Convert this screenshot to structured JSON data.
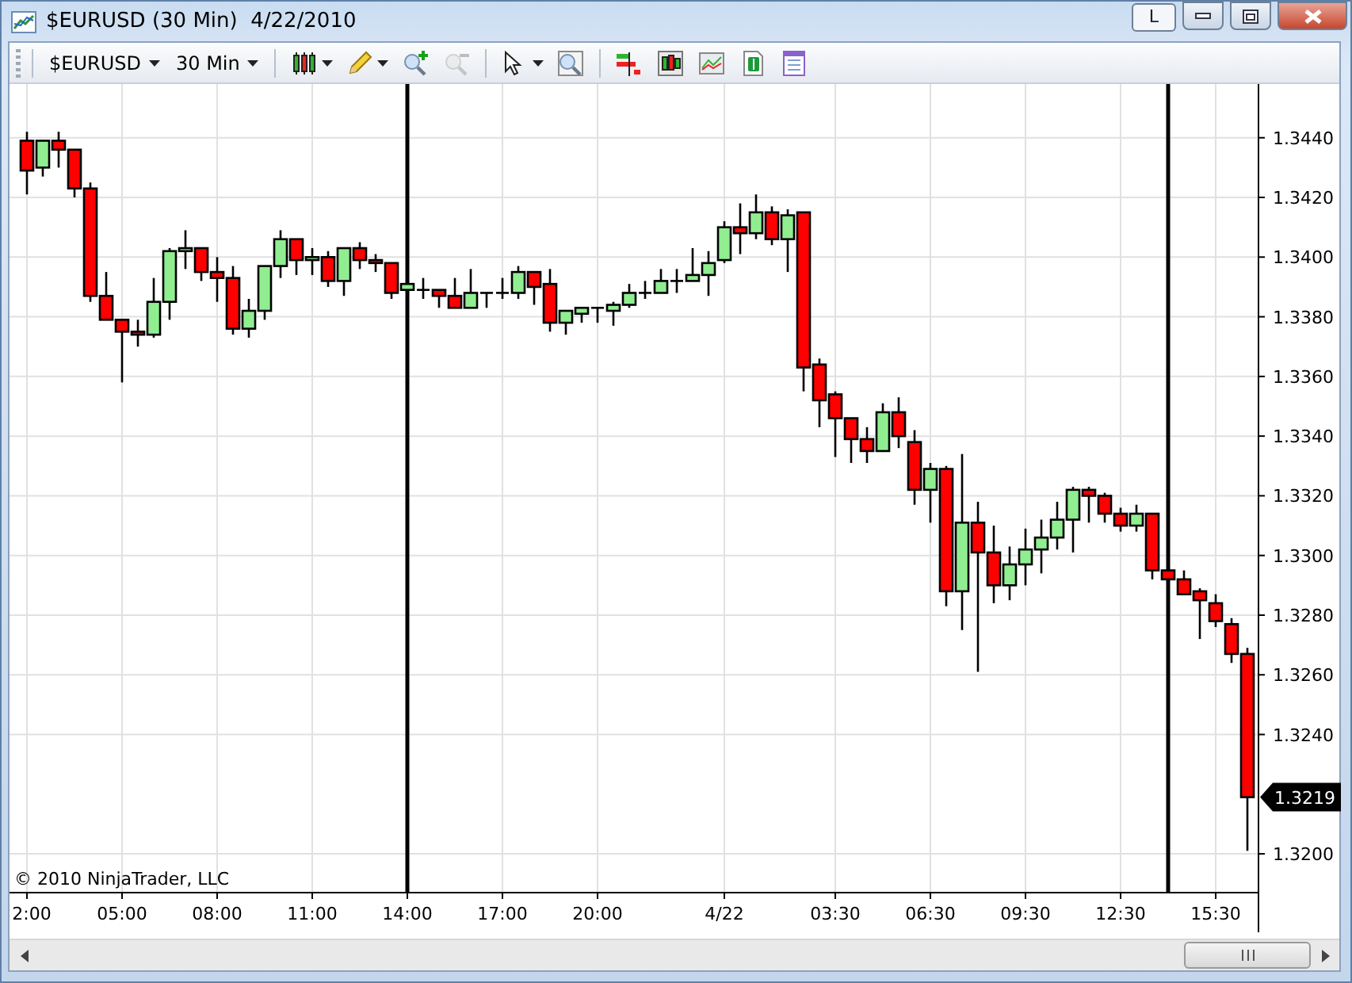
{
  "window": {
    "title": "$EURUSD (30 Min)  4/22/2010",
    "buttons": [
      {
        "kind": "link",
        "label": "L"
      },
      {
        "kind": "minimize"
      },
      {
        "kind": "maximize"
      },
      {
        "kind": "close"
      }
    ]
  },
  "toolbar": {
    "dropdowns": [
      {
        "label": "$EURUSD"
      },
      {
        "label": "30 Min"
      }
    ],
    "tools": [
      {
        "kind": "chart-style",
        "disabled": false
      },
      {
        "kind": "drawing",
        "disabled": false
      },
      {
        "kind": "zoom-in",
        "disabled": false
      },
      {
        "kind": "zoom-out",
        "disabled": true
      },
      {
        "kind": "separator"
      },
      {
        "kind": "select",
        "disabled": false
      },
      {
        "kind": "zoom",
        "disabled": false
      },
      {
        "kind": "separator"
      },
      {
        "kind": "strategies",
        "disabled": false
      },
      {
        "kind": "indicators",
        "disabled": false
      },
      {
        "kind": "line-chart",
        "disabled": false
      },
      {
        "kind": "account",
        "disabled": false
      },
      {
        "kind": "properties",
        "disabled": false
      }
    ]
  },
  "chart": {
    "copyright": "© 2010 NinjaTrader, LLC",
    "last_price": "1.3219",
    "chart_data": {
      "type": "candlestick",
      "grid": true,
      "ylim": [
        1.3187,
        1.3458
      ],
      "categories": [
        "2:00",
        null,
        null,
        null,
        null,
        null,
        "05:00",
        null,
        null,
        null,
        null,
        null,
        "08:00",
        null,
        null,
        null,
        null,
        null,
        "11:00",
        null,
        null,
        null,
        null,
        null,
        "14:00",
        null,
        null,
        null,
        null,
        null,
        "17:00",
        null,
        null,
        null,
        null,
        null,
        "20:00",
        null,
        null,
        null,
        null,
        null,
        null,
        null,
        "4/22",
        null,
        null,
        null,
        null,
        null,
        null,
        "03:30",
        null,
        null,
        null,
        null,
        null,
        "06:30",
        null,
        null,
        null,
        null,
        null,
        "09:30",
        null,
        null,
        null,
        null,
        null,
        "12:30",
        null,
        null,
        null,
        null,
        null,
        "15:30",
        null,
        null
      ],
      "yticks": [
        {
          "value": 1.32,
          "label": "1.3200"
        },
        {
          "value": 1.324,
          "label": "1.3240"
        },
        {
          "value": 1.326,
          "label": "1.3260"
        },
        {
          "value": 1.328,
          "label": "1.3280"
        },
        {
          "value": 1.33,
          "label": "1.3300"
        },
        {
          "value": 1.332,
          "label": "1.3320"
        },
        {
          "value": 1.334,
          "label": "1.3340"
        },
        {
          "value": 1.336,
          "label": "1.3360"
        },
        {
          "value": 1.338,
          "label": "1.3380"
        },
        {
          "value": 1.34,
          "label": "1.3400"
        },
        {
          "value": 1.342,
          "label": "1.3420"
        },
        {
          "value": 1.344,
          "label": "1.3440"
        }
      ],
      "ohlc": [
        [
          1.3439,
          1.3442,
          1.3421,
          1.3429
        ],
        [
          1.343,
          1.3439,
          1.3427,
          1.3439
        ],
        [
          1.3439,
          1.3442,
          1.343,
          1.3436
        ],
        [
          1.3436,
          1.3436,
          1.342,
          1.3423
        ],
        [
          1.3423,
          1.3425,
          1.3385,
          1.3387
        ],
        [
          1.3387,
          1.3395,
          1.3379,
          1.3379
        ],
        [
          1.3379,
          1.3379,
          1.3358,
          1.3375
        ],
        [
          1.3375,
          1.3379,
          1.337,
          1.3374
        ],
        [
          1.3374,
          1.3393,
          1.3373,
          1.3385
        ],
        [
          1.3385,
          1.3403,
          1.3379,
          1.3402
        ],
        [
          1.3402,
          1.3409,
          1.3396,
          1.3403
        ],
        [
          1.3403,
          1.3403,
          1.3392,
          1.3395
        ],
        [
          1.3395,
          1.34,
          1.3385,
          1.3393
        ],
        [
          1.3393,
          1.3397,
          1.3374,
          1.3376
        ],
        [
          1.3376,
          1.3386,
          1.3373,
          1.3382
        ],
        [
          1.3382,
          1.3397,
          1.3379,
          1.3397
        ],
        [
          1.3397,
          1.3409,
          1.3393,
          1.3406
        ],
        [
          1.3406,
          1.3406,
          1.3394,
          1.3399
        ],
        [
          1.3399,
          1.3403,
          1.3394,
          1.34
        ],
        [
          1.34,
          1.3402,
          1.339,
          1.3392
        ],
        [
          1.3392,
          1.3403,
          1.3387,
          1.3403
        ],
        [
          1.3403,
          1.3405,
          1.3396,
          1.3399
        ],
        [
          1.3399,
          1.3401,
          1.3395,
          1.3398
        ],
        [
          1.3398,
          1.3398,
          1.3386,
          1.3388
        ],
        [
          1.3389,
          1.3391,
          1.3389,
          1.3391
        ],
        [
          1.3389,
          1.3393,
          1.3386,
          1.3389
        ],
        [
          1.3389,
          1.3389,
          1.3383,
          1.3387
        ],
        [
          1.3387,
          1.3393,
          1.3383,
          1.3383
        ],
        [
          1.3383,
          1.3396,
          1.3383,
          1.3388
        ],
        [
          1.3388,
          1.3388,
          1.3383,
          1.3388
        ],
        [
          1.3388,
          1.3393,
          1.3386,
          1.3388
        ],
        [
          1.3388,
          1.3397,
          1.3386,
          1.3395
        ],
        [
          1.3395,
          1.3395,
          1.3384,
          1.339
        ],
        [
          1.3391,
          1.3396,
          1.3375,
          1.3378
        ],
        [
          1.3378,
          1.3382,
          1.3374,
          1.3382
        ],
        [
          1.3381,
          1.3383,
          1.3378,
          1.3383
        ],
        [
          1.3383,
          1.3383,
          1.3378,
          1.3383
        ],
        [
          1.3382,
          1.3385,
          1.3377,
          1.3384
        ],
        [
          1.3384,
          1.3391,
          1.3383,
          1.3388
        ],
        [
          1.3388,
          1.3392,
          1.3386,
          1.3388
        ],
        [
          1.3388,
          1.3396,
          1.3388,
          1.3392
        ],
        [
          1.3392,
          1.3396,
          1.3388,
          1.3392
        ],
        [
          1.3392,
          1.3403,
          1.3392,
          1.3394
        ],
        [
          1.3394,
          1.3402,
          1.3387,
          1.3398
        ],
        [
          1.3399,
          1.3412,
          1.3398,
          1.341
        ],
        [
          1.341,
          1.3418,
          1.3401,
          1.3408
        ],
        [
          1.3408,
          1.3421,
          1.3406,
          1.3415
        ],
        [
          1.3415,
          1.3417,
          1.3404,
          1.3406
        ],
        [
          1.3406,
          1.3416,
          1.3395,
          1.3414
        ],
        [
          1.3415,
          1.3415,
          1.3355,
          1.3363
        ],
        [
          1.3364,
          1.3366,
          1.3343,
          1.3352
        ],
        [
          1.3354,
          1.3355,
          1.3333,
          1.3346
        ],
        [
          1.3346,
          1.3346,
          1.3331,
          1.3339
        ],
        [
          1.3339,
          1.3343,
          1.3331,
          1.3335
        ],
        [
          1.3335,
          1.3351,
          1.3335,
          1.3348
        ],
        [
          1.3348,
          1.3353,
          1.3336,
          1.334
        ],
        [
          1.3338,
          1.3342,
          1.3317,
          1.3322
        ],
        [
          1.3322,
          1.3331,
          1.3311,
          1.3329
        ],
        [
          1.3329,
          1.333,
          1.3283,
          1.3288
        ],
        [
          1.3288,
          1.3334,
          1.3275,
          1.3311
        ],
        [
          1.3311,
          1.3318,
          1.3261,
          1.3301
        ],
        [
          1.3301,
          1.331,
          1.3284,
          1.329
        ],
        [
          1.329,
          1.3303,
          1.3285,
          1.3297
        ],
        [
          1.3297,
          1.3309,
          1.329,
          1.3302
        ],
        [
          1.3302,
          1.3312,
          1.3294,
          1.3306
        ],
        [
          1.3306,
          1.3318,
          1.3302,
          1.3312
        ],
        [
          1.3312,
          1.3323,
          1.3301,
          1.3322
        ],
        [
          1.3322,
          1.3323,
          1.3311,
          1.332
        ],
        [
          1.332,
          1.3321,
          1.3311,
          1.3314
        ],
        [
          1.3314,
          1.3316,
          1.3308,
          1.331
        ],
        [
          1.331,
          1.3317,
          1.3308,
          1.3314
        ],
        [
          1.3314,
          1.3314,
          1.3292,
          1.3295
        ],
        [
          1.3295,
          1.3295,
          1.3292,
          1.3292
        ],
        [
          1.3292,
          1.3295,
          1.3287,
          1.3287
        ],
        [
          1.3288,
          1.3289,
          1.3272,
          1.3285
        ],
        [
          1.3284,
          1.3287,
          1.3276,
          1.3278
        ],
        [
          1.3277,
          1.3279,
          1.3264,
          1.3267
        ],
        [
          1.3267,
          1.3269,
          1.3201,
          1.3219
        ]
      ]
    }
  }
}
